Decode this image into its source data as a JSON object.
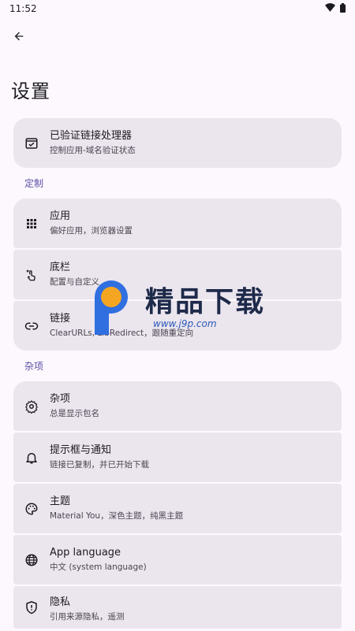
{
  "status": {
    "time": "11:52"
  },
  "page": {
    "title": "设置"
  },
  "sections": {
    "customize": "定制",
    "misc": "杂项"
  },
  "items": {
    "verified_links": {
      "title": "已验证链接处理器",
      "subtitle": "控制应用-域名验证状态"
    },
    "apps": {
      "title": "应用",
      "subtitle": "偏好应用，浏览器设置"
    },
    "bottom_bar": {
      "title": "底栏",
      "subtitle": "配置与自定义"
    },
    "links": {
      "title": "链接",
      "subtitle": "ClearURLs, LibRedirect，跟随重定向"
    },
    "misc": {
      "title": "杂项",
      "subtitle": "总是显示包名"
    },
    "notifications": {
      "title": "提示框与通知",
      "subtitle": "链接已复制，并已开始下载"
    },
    "theme": {
      "title": "主题",
      "subtitle": "Material You，深色主题，纯黑主题"
    },
    "language": {
      "title": "App language",
      "subtitle": "中文 (system language)"
    },
    "privacy": {
      "title": "隐私",
      "subtitle": "引用来源隐私，遥测"
    }
  },
  "watermark": {
    "title": "精品下载",
    "url": "www.j9p.com"
  },
  "colors": {
    "card": "#ebe5ee",
    "accent": "#5b4fa6",
    "background": "#fdf8fd"
  }
}
